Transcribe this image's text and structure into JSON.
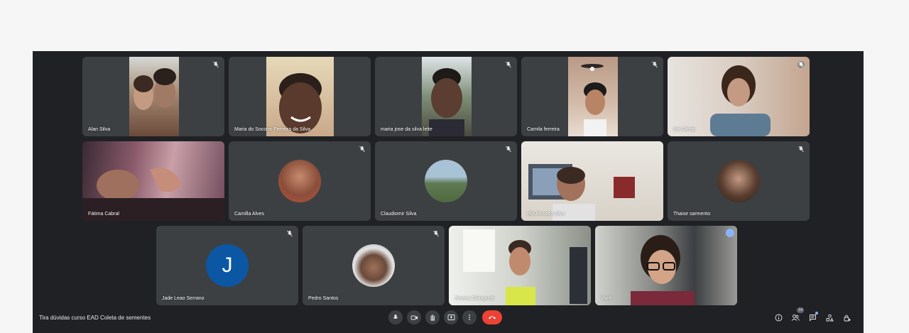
{
  "meeting": {
    "title": "Tira dúvidas curso EAD Coleta de sementes",
    "participants_count": "14"
  },
  "participants": {
    "p1": {
      "name": "Alan Silva",
      "muted": true
    },
    "p2": {
      "name": "Maria do Socorro Ferreira da Silva",
      "muted": false
    },
    "p3": {
      "name": "maria jose da silva leite",
      "muted": true
    },
    "p4": {
      "name": "Camila ferreira",
      "muted": true
    },
    "p5": {
      "name": "Isis Dinep",
      "muted": false
    },
    "p6": {
      "name": "Fátima Cabral",
      "muted": false
    },
    "p7": {
      "name": "Camilla Alves",
      "muted": true
    },
    "p8": {
      "name": "Claudiomir Silva",
      "muted": true
    },
    "p9": {
      "name": "elia fonseca silva",
      "muted": false
    },
    "p10": {
      "name": "Thaise sarmento",
      "muted": true
    },
    "p11": {
      "name": "Jade Leao Serrano",
      "muted": true,
      "initial": "J"
    },
    "p12": {
      "name": "Pedro Santos",
      "muted": true
    },
    "p13": {
      "name": "Jimena Stringuetti",
      "muted": false
    },
    "p14": {
      "name": "Você",
      "muted": false
    }
  },
  "icons": {
    "mic": "microphone-icon",
    "camera": "camera-icon",
    "hand": "raise-hand-icon",
    "present": "present-screen-icon",
    "more": "more-options-icon",
    "leave": "leave-call-icon",
    "info": "info-icon",
    "people": "people-icon",
    "chat": "chat-icon",
    "activities": "activities-icon",
    "host": "host-controls-icon",
    "muted": "mic-off-icon"
  },
  "colors": {
    "background": "#202124",
    "tile": "#3c4043",
    "leave": "#ea4335",
    "accent": "#8ab4f8",
    "avatar_j": "#0b57a4"
  }
}
